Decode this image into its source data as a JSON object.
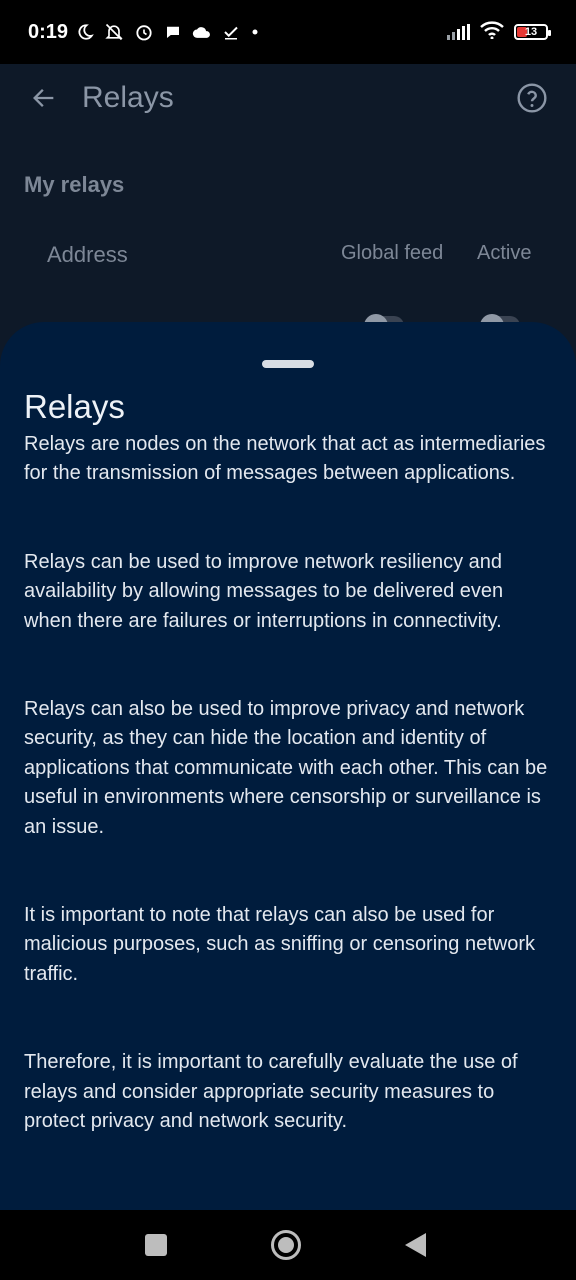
{
  "status_bar": {
    "time": "0:19",
    "battery_level": "13",
    "icons": [
      "moon-icon",
      "muted-bell-icon",
      "alarm-icon",
      "chat-icon",
      "cloud-icon",
      "check-icon",
      "dot-icon",
      "signal-icon",
      "wifi-icon",
      "battery-icon"
    ]
  },
  "app_bar": {
    "title": "Relays",
    "back_icon": "arrow-left-icon",
    "help_icon": "help-circle-icon"
  },
  "relays_section": {
    "title": "My relays",
    "columns": [
      "Address",
      "Global feed",
      "Active"
    ]
  },
  "sheet": {
    "title": "Relays",
    "paragraphs": [
      "Relays are nodes on the network that act as intermediaries for the transmission of messages between applications.",
      "Relays can be used to improve network resiliency and availability by allowing messages to be delivered even when there are failures or interruptions in connectivity.",
      "Relays can also be used to improve privacy and network security, as they can hide the location and identity of applications that communicate with each other. This can be useful in environments where censorship or surveillance is an issue.",
      "It is important to note that relays can also be used for malicious purposes, such as sniffing or censoring network traffic.",
      "Therefore, it is important to carefully evaluate the use of relays and consider appropriate security measures to protect privacy and network security."
    ]
  },
  "nav_bar": {
    "icons": [
      "recent-apps-icon",
      "home-icon",
      "back-icon"
    ]
  },
  "colors": {
    "sheet_background": "#001c3d",
    "app_background": "#0e1928",
    "battery_low": "#e53935"
  }
}
